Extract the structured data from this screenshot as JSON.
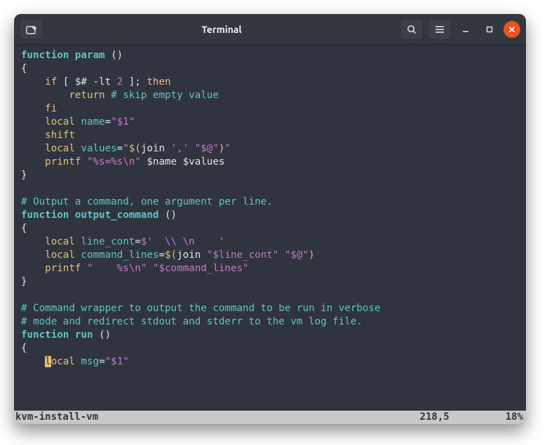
{
  "titlebar": {
    "title": "Terminal",
    "new_tab_icon": "new-tab-icon",
    "search_icon": "search-icon",
    "menu_icon": "hamburger-icon",
    "minimize_icon": "minimize-icon",
    "maximize_icon": "maximize-icon",
    "close_icon": "close-icon"
  },
  "code": {
    "l1_function": "function",
    "l1_name": " param ",
    "l1_parens": "()",
    "l2": "{",
    "l3_if": "    if",
    "l3_rest": " [ $# -lt ",
    "l3_num": "2",
    "l3_rest2": " ]; ",
    "l3_then": "then",
    "l4_return": "        return",
    "l4_cm": " # skip empty value",
    "l5_fi": "    fi",
    "l6_local": "    local",
    "l6_name": " name",
    "l6_eq": "=",
    "l6_val": "\"$1\"",
    "l7_shift": "    shift",
    "l8_local": "    local",
    "l8_name": " values",
    "l8_eq": "=",
    "l8_val1": "\"",
    "l8_val2": "$(",
    "l8_val3": "join ",
    "l8_val4": "','",
    "l8_val5": " ",
    "l8_val6": "\"$@\"",
    "l8_val7": ")",
    "l8_val8": "\"",
    "l9_printf": "    printf",
    "l9_str": " \"%s=%s\\n\"",
    "l9_args": " $name $values",
    "l10": "}",
    "l11": "",
    "l12_cm": "# Output a command, one argument per line.",
    "l13_function": "function",
    "l13_name": " output_command ",
    "l13_parens": "()",
    "l14": "{",
    "l15_local": "    local",
    "l15_name": " line_cont",
    "l15_eq": "=",
    "l15_val": "$'  \\\\ \\n    '",
    "l16_local": "    local",
    "l16_name": " command_lines",
    "l16_eq": "=",
    "l16_val1": "$(",
    "l16_val2": "join ",
    "l16_val3": "\"$line_cont\"",
    "l16_val4": " ",
    "l16_val5": "\"$@\"",
    "l16_val6": ")",
    "l17_printf": "    printf",
    "l17_str": " \"    %s\\n\"",
    "l17_arg": " \"$command_lines\"",
    "l18": "}",
    "l19": "",
    "l20_cm": "# Command wrapper to output the command to be run in verbose",
    "l21_cm": "# mode and redirect stdout and stderr to the vm log file.",
    "l22_function": "function",
    "l22_name": " run ",
    "l22_parens": "()",
    "l23": "{",
    "l24_pre": "    ",
    "l24_cur": "l",
    "l24_local": "ocal",
    "l24_name": " msg",
    "l24_eq": "=",
    "l24_val": "\"$1\""
  },
  "status": {
    "filename": "kvm-install-vm",
    "position": "218,5",
    "percent": "18%"
  }
}
